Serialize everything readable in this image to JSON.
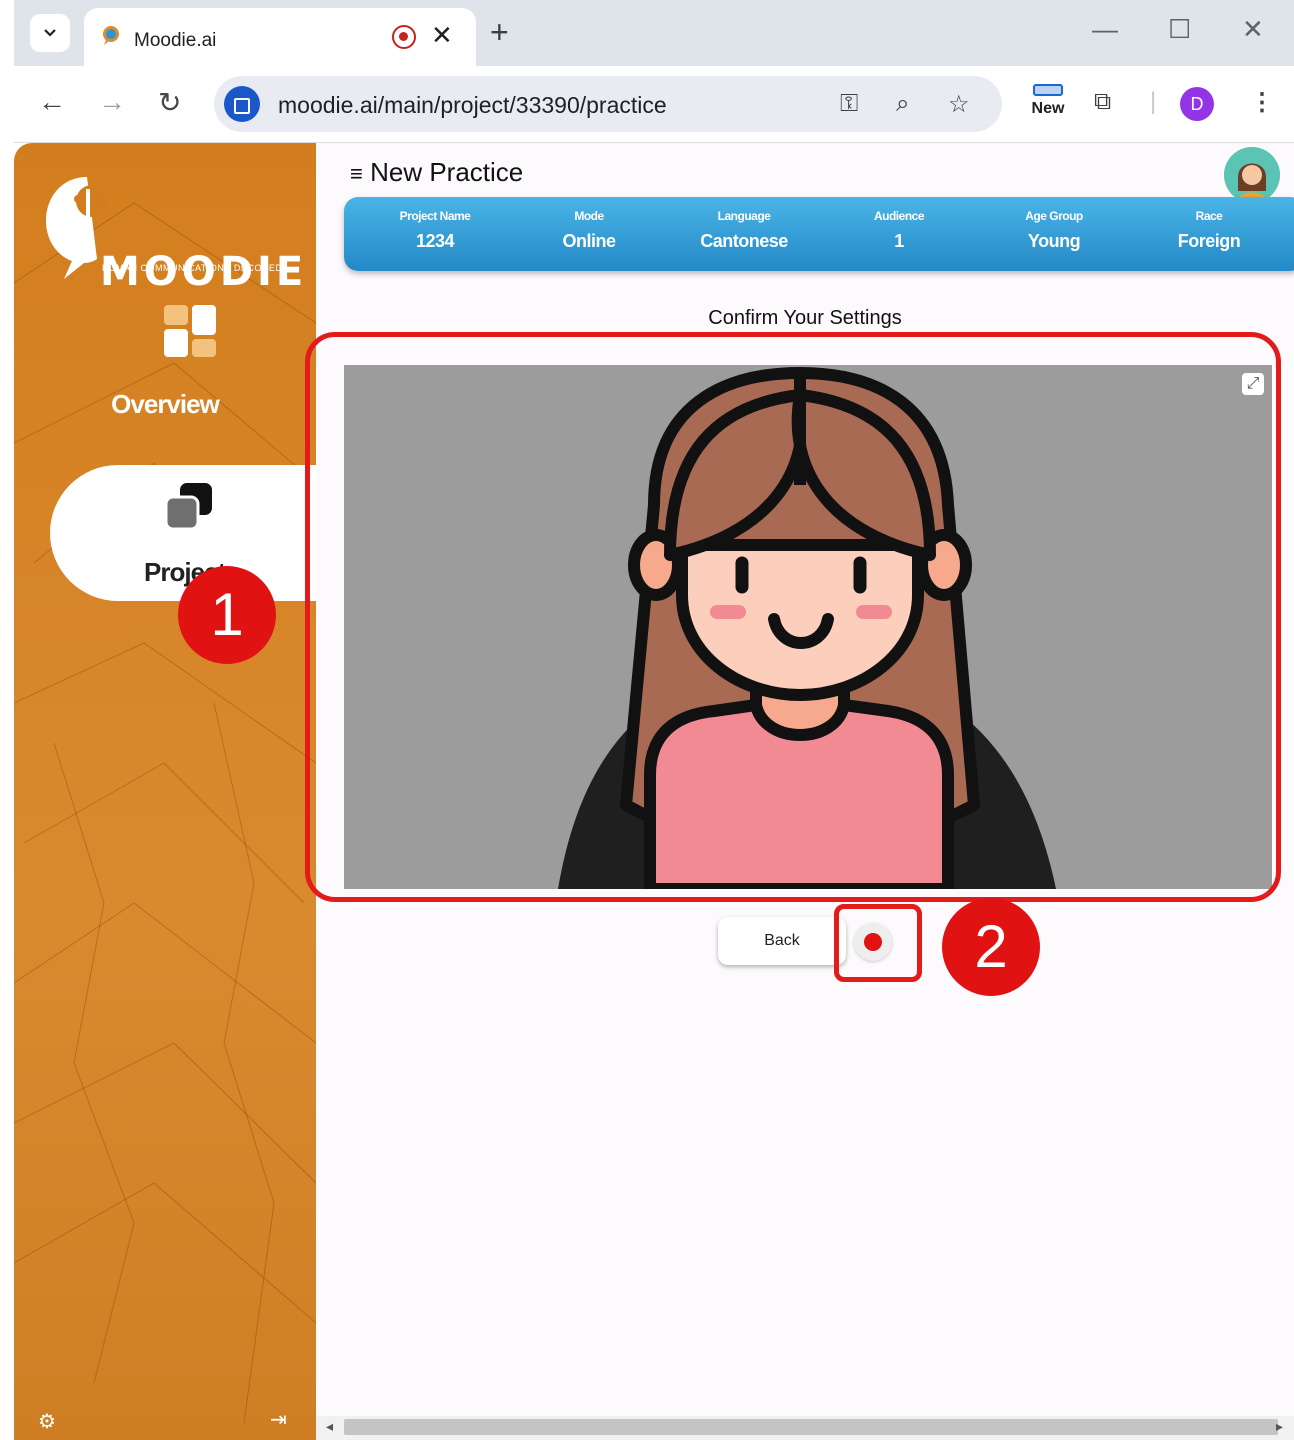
{
  "browser": {
    "tab_title": "Moodie.ai",
    "url": "moodie.ai/main/project/33390/practice",
    "new_badge": "New",
    "profile_initial": "D",
    "close_glyph": "✕",
    "newtab_glyph": "+"
  },
  "sidebar": {
    "logo_text": "MOODIE",
    "logo_subtitle": "HUMAN COMMUNICATIONS DECODED",
    "items": [
      {
        "label": "Overview",
        "icon": "dashboard-icon",
        "active": false
      },
      {
        "label": "Projects",
        "icon": "projects-icon",
        "active": true
      }
    ]
  },
  "header": {
    "title": "New Practice"
  },
  "info": {
    "project_name_label": "Project Name",
    "project_name": "1234",
    "mode_label": "Mode",
    "mode": "Online",
    "language_label": "Language",
    "language": "Cantonese",
    "audience_label": "Audience",
    "audience": "1",
    "age_group_label": "Age Group",
    "age_group": "Young",
    "race_label": "Race",
    "race": "Foreign"
  },
  "main": {
    "confirm_text": "Confirm Your Settings",
    "back_label": "Back"
  },
  "annotations": {
    "badge1": "1",
    "badge2": "2",
    "highlight_color": "#e31b1b"
  },
  "colors": {
    "sidebar": "#d37e1e",
    "infobar": "#2b96d3",
    "record": "#e01212"
  }
}
